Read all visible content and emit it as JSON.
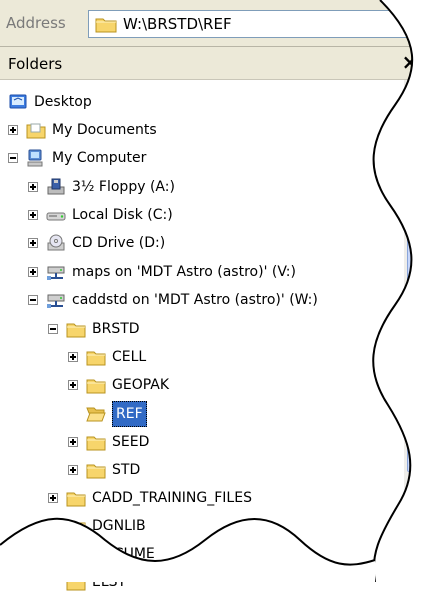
{
  "address_bar": {
    "label": "Address",
    "path": "W:\\BRSTD\\REF"
  },
  "folders_panel": {
    "title": "Folders",
    "close_glyph": "×"
  },
  "tree": [
    {
      "label": "Desktop",
      "icon": "desktop-icon",
      "expander": "none"
    },
    {
      "label": "My Documents",
      "icon": "folder-documents-icon",
      "expander": "plus"
    },
    {
      "label": "My Computer",
      "icon": "computer-icon",
      "expander": "minus"
    },
    {
      "label": "3½ Floppy (A:)",
      "icon": "floppy-drive-icon",
      "expander": "plus"
    },
    {
      "label": "Local Disk (C:)",
      "icon": "hard-disk-icon",
      "expander": "plus"
    },
    {
      "label": "CD Drive (D:)",
      "icon": "cd-drive-icon",
      "expander": "plus"
    },
    {
      "label": "maps on 'MDT Astro (astro)' (V:)",
      "icon": "network-drive-icon",
      "expander": "plus"
    },
    {
      "label": "caddstd on 'MDT Astro (astro)' (W:)",
      "icon": "network-drive-icon",
      "expander": "minus"
    },
    {
      "label": "BRSTD",
      "icon": "folder-icon",
      "expander": "minus"
    },
    {
      "label": "CELL",
      "icon": "folder-icon",
      "expander": "plus"
    },
    {
      "label": "GEOPAK",
      "icon": "folder-icon",
      "expander": "plus"
    },
    {
      "label": "REF",
      "icon": "open-folder-icon",
      "expander": "none",
      "selected": true
    },
    {
      "label": "SEED",
      "icon": "folder-icon",
      "expander": "plus"
    },
    {
      "label": "STD",
      "icon": "folder-icon",
      "expander": "plus"
    },
    {
      "label": "CADD_TRAINING_FILES",
      "icon": "folder-icon",
      "expander": "plus"
    },
    {
      "label": "DGNLIB",
      "icon": "folder-icon",
      "expander": "plus"
    },
    {
      "label": "DOCUME",
      "icon": "folder-icon",
      "expander": "none"
    },
    {
      "label": "ELST",
      "icon": "folder-icon",
      "expander": "none"
    }
  ],
  "colors": {
    "selection": "#316ac5",
    "folder": "#f7d56b",
    "chrome": "#ece9d8"
  }
}
